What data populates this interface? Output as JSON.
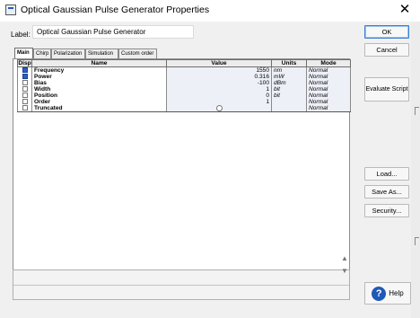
{
  "window": {
    "title": "Optical Gaussian Pulse Generator Properties",
    "icon": "app-icon",
    "close_glyph": "✕"
  },
  "label": {
    "caption": "Label:",
    "value": "Optical Gaussian Pulse Generator"
  },
  "tabs": [
    "Main",
    "Chirp",
    "Polarization",
    "Simulation",
    "Custom order"
  ],
  "table": {
    "headers": [
      "Disp",
      "Name",
      "Value",
      "Units",
      "Mode"
    ],
    "rows": [
      {
        "disp": "checked",
        "name": "Frequency",
        "value": "1550",
        "units": "nm",
        "mode": "Normal"
      },
      {
        "disp": "checked",
        "name": "Power",
        "value": "0.316",
        "units": "mW",
        "mode": "Normal"
      },
      {
        "disp": "unchecked",
        "name": "Bias",
        "value": "-100",
        "units": "dBm",
        "mode": "Normal"
      },
      {
        "disp": "unchecked",
        "name": "Width",
        "value": "1",
        "units": "bit",
        "mode": "Normal"
      },
      {
        "disp": "unchecked",
        "name": "Position",
        "value": "0",
        "units": "bit",
        "mode": "Normal"
      },
      {
        "disp": "unchecked",
        "name": "Order",
        "value": "1",
        "units": "",
        "mode": "Normal"
      },
      {
        "disp": "unchecked",
        "name": "Truncated",
        "value": "",
        "units": "",
        "mode": "Normal"
      }
    ]
  },
  "buttons": {
    "ok": "OK",
    "cancel": "Cancel",
    "evaluate": "Evaluate Script",
    "load": "Load...",
    "save_as": "Save As...",
    "security": "Security...",
    "help": "Help"
  },
  "icons": {
    "help": "?",
    "scroll_up": "▲",
    "scroll_down": "▼"
  },
  "colors": {
    "checkbox_checked": "#2b5fc5",
    "help_icon": "#1f59b8",
    "value_cell_bg": "#eef0f8"
  }
}
